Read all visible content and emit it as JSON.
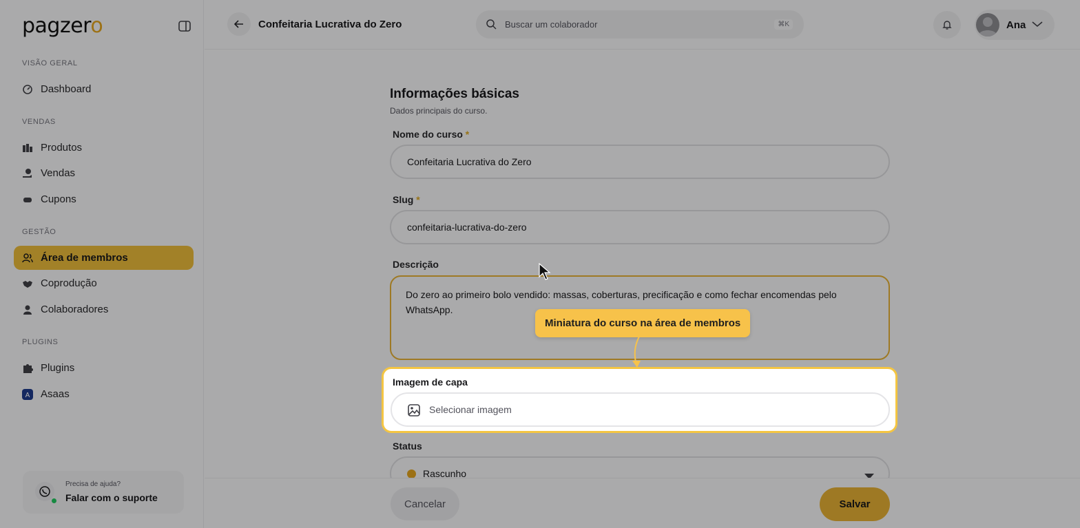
{
  "brand": {
    "logo_main": "pagzer",
    "logo_accent": "o"
  },
  "sidebar": {
    "sections": [
      {
        "label": "VISÃO GERAL"
      },
      {
        "label": "VENDAS"
      },
      {
        "label": "GESTÃO"
      },
      {
        "label": "PLUGINS"
      }
    ],
    "items": [
      {
        "label": "Dashboard",
        "icon": "gauge-icon"
      },
      {
        "label": "Produtos",
        "icon": "package-icon"
      },
      {
        "label": "Vendas",
        "icon": "money-hand-icon"
      },
      {
        "label": "Cupons",
        "icon": "ticket-icon"
      },
      {
        "label": "Área de membros",
        "icon": "users-icon",
        "active": true
      },
      {
        "label": "Coprodução",
        "icon": "handshake-icon"
      },
      {
        "label": "Colaboradores",
        "icon": "user-icon"
      },
      {
        "label": "Plugins",
        "icon": "puzzle-icon"
      },
      {
        "label": "Asaas",
        "icon": "asaas-logo-icon"
      }
    ],
    "help": {
      "small": "Precisa de ajuda?",
      "big": "Falar com o suporte"
    }
  },
  "header": {
    "title": "Confeitaria Lucrativa do Zero",
    "search_placeholder": "Buscar um colaborador",
    "search_shortcut": "⌘K",
    "user_name": "Ana"
  },
  "form": {
    "title": "Informações básicas",
    "subtitle": "Dados principais do curso.",
    "name_label": "Nome do curso",
    "name_value": "Confeitaria Lucrativa do Zero",
    "slug_label": "Slug",
    "slug_value": "confeitaria-lucrativa-do-zero",
    "required_mark": "*",
    "desc_label": "Descrição",
    "desc_value": "Do zero ao primeiro bolo vendido: massas, coberturas, precificação e como fechar encomendas pelo WhatsApp.",
    "cover_label": "Imagem de capa",
    "cover_button": "Selecionar imagem",
    "status_label": "Status",
    "status_value": "Rascunho"
  },
  "tooltip": {
    "text": "Miniatura do curso na área de membros"
  },
  "footer": {
    "cancel": "Cancelar",
    "save": "Salvar"
  },
  "colors": {
    "accent": "#e2ae34",
    "tooltip": "#f7c24a",
    "spotlight_border": "#f4c542"
  }
}
